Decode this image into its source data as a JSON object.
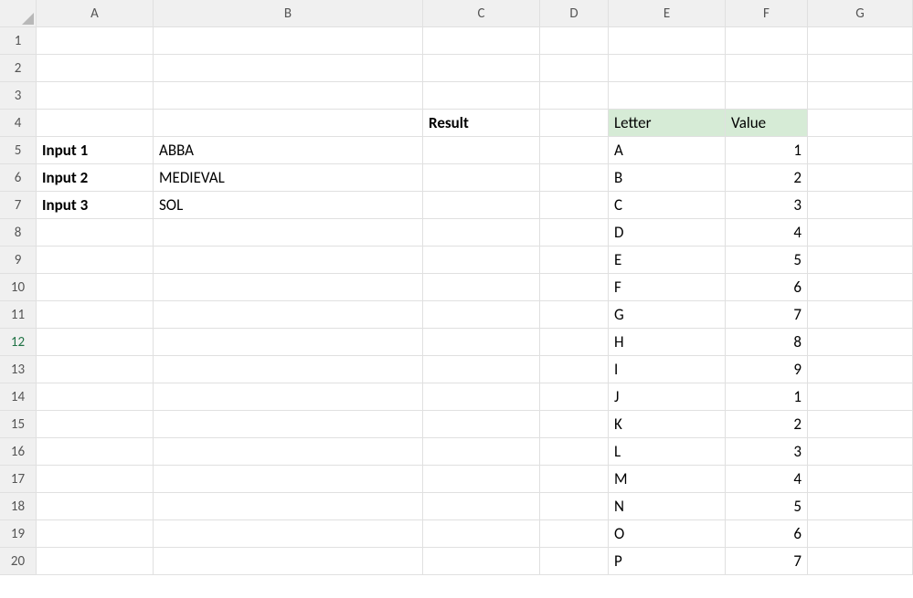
{
  "columns": [
    "A",
    "B",
    "C",
    "D",
    "E",
    "F",
    "G"
  ],
  "rows": [
    "1",
    "2",
    "3",
    "4",
    "5",
    "6",
    "7",
    "8",
    "9",
    "10",
    "11",
    "12",
    "13",
    "14",
    "15",
    "16",
    "17",
    "18",
    "19",
    "20"
  ],
  "selected_row": "12",
  "labels": {
    "result": "Result",
    "input1": "Input 1",
    "input2": "Input 2",
    "input3": "Input 3",
    "letter": "Letter",
    "value": "Value"
  },
  "inputs": {
    "b5": "ABBA",
    "b6": "MEDIEVAL",
    "b7": "SOL"
  },
  "lookup": [
    {
      "letter": "A",
      "value": "1"
    },
    {
      "letter": "B",
      "value": "2"
    },
    {
      "letter": "C",
      "value": "3"
    },
    {
      "letter": "D",
      "value": "4"
    },
    {
      "letter": "E",
      "value": "5"
    },
    {
      "letter": "F",
      "value": "6"
    },
    {
      "letter": "G",
      "value": "7"
    },
    {
      "letter": "H",
      "value": "8"
    },
    {
      "letter": "I",
      "value": "9"
    },
    {
      "letter": "J",
      "value": "1"
    },
    {
      "letter": "K",
      "value": "2"
    },
    {
      "letter": "L",
      "value": "3"
    },
    {
      "letter": "M",
      "value": "4"
    },
    {
      "letter": "N",
      "value": "5"
    },
    {
      "letter": "O",
      "value": "6"
    },
    {
      "letter": "P",
      "value": "7"
    }
  ]
}
